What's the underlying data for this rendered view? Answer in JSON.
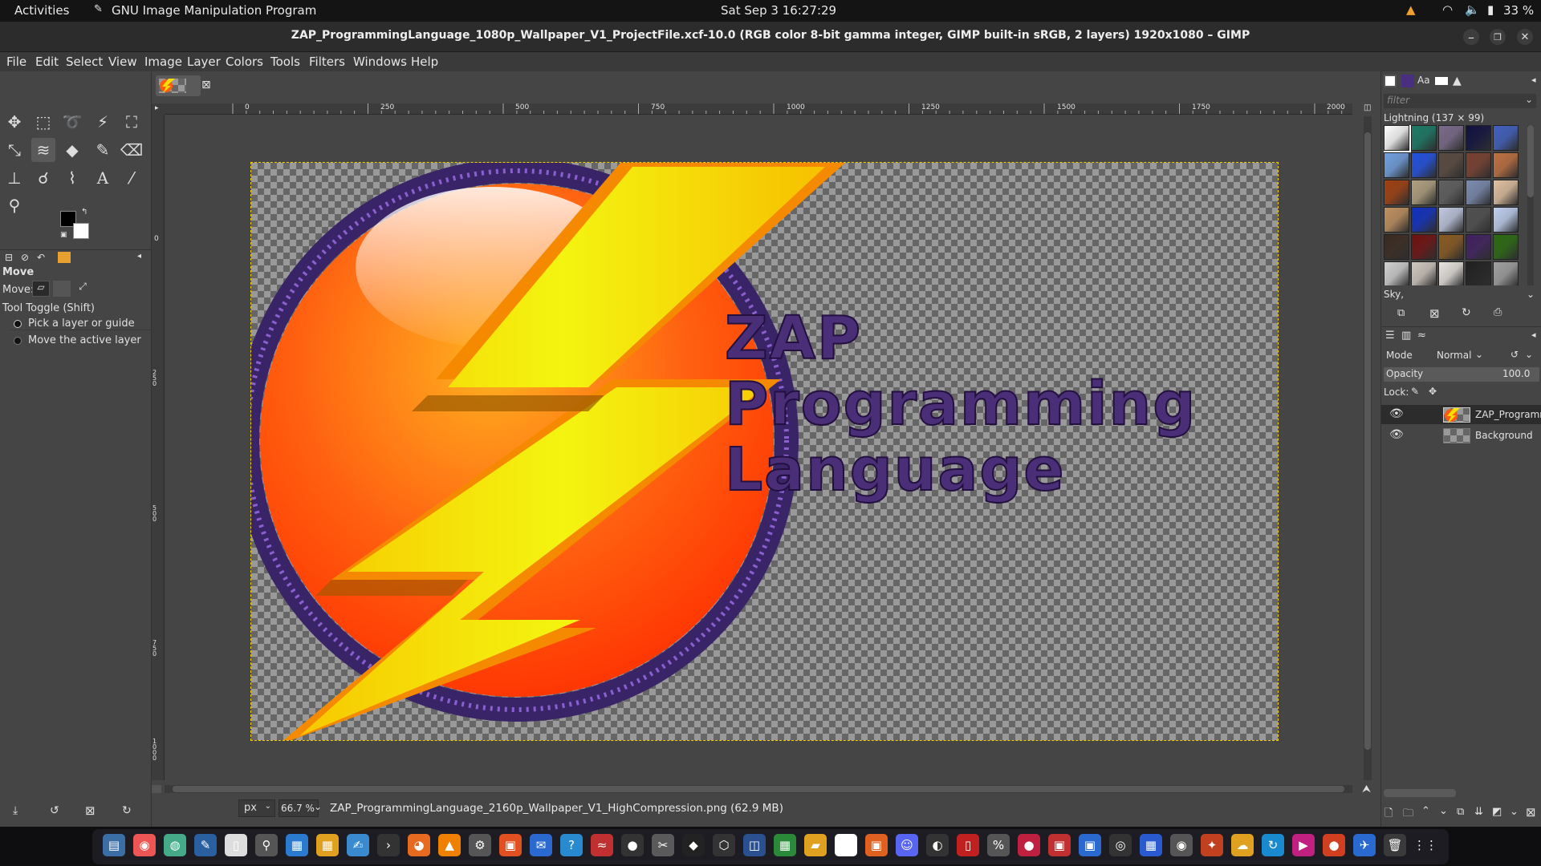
{
  "topbar": {
    "activities": "Activities",
    "app_name": "GNU Image Manipulation Program",
    "clock": "Sat Sep 3  16:27:29",
    "battery": "33 %"
  },
  "window": {
    "title": "ZAP_ProgrammingLanguage_1080p_Wallpaper_V1_ProjectFile.xcf-10.0 (RGB color 8-bit gamma integer, GIMP built-in sRGB, 2 layers) 1920x1080 – GIMP"
  },
  "menu": [
    "File",
    "Edit",
    "Select",
    "View",
    "Image",
    "Layer",
    "Colors",
    "Tools",
    "Filters",
    "Windows",
    "Help"
  ],
  "tool_options": {
    "title": "Move",
    "move_label": "Move:",
    "toggle_label": "Tool Toggle  (Shift)",
    "option1": "Pick a layer or guide",
    "option2": "Move the active layer"
  },
  "ruler": {
    "h_ticks": [
      "0",
      "250",
      "500",
      "750",
      "1000",
      "1250",
      "1500",
      "1750",
      "2000"
    ],
    "v_ticks": [
      "0",
      "250",
      "500",
      "750",
      "1000"
    ]
  },
  "canvas_text": {
    "line1": "ZAP",
    "line2": "Programming",
    "line3": "Language"
  },
  "statusbar": {
    "unit": "px",
    "zoom": "66.7 %",
    "message": "ZAP_ProgrammingLanguage_2160p_Wallpaper_V1_HighCompression.png (62.9 MB)"
  },
  "patterns": {
    "filter_placeholder": "filter",
    "current": "Lightning (137 × 99)",
    "selected_name": "Sky,"
  },
  "layers": {
    "mode_label": "Mode",
    "mode_value": "Normal",
    "opacity_label": "Opacity",
    "opacity_value": "100.0",
    "lock_label": "Lock:",
    "items": [
      {
        "name": "ZAP_Programr"
      },
      {
        "name": "Background"
      }
    ]
  },
  "colors": {
    "accent": "#f5d000",
    "panel_bg": "#454545",
    "topbar_bg": "#141414"
  }
}
